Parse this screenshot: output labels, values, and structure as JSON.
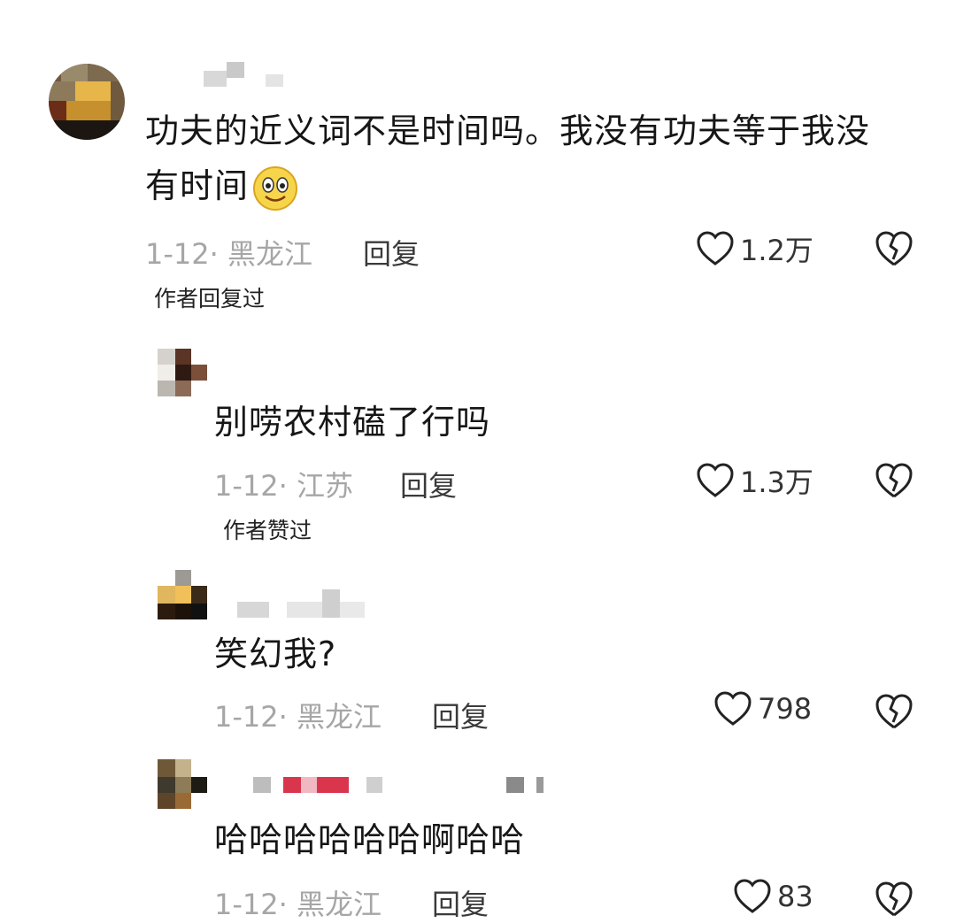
{
  "comments": [
    {
      "text_line1": "功夫的近义词不是时间吗。我没有功夫等于我没",
      "text_line2": "有时间",
      "emoji": "smiling-face-icon",
      "date": "1-12",
      "location": "黑龙江",
      "reply_label": "回复",
      "likes": "1.2万",
      "author_tag": "作者回复过"
    },
    {
      "text": "别唠农村磕了行吗",
      "date": "1-12",
      "location": "江苏",
      "reply_label": "回复",
      "likes": "1.3万",
      "author_tag": "作者赞过"
    },
    {
      "text": "笑幻我?",
      "date": "1-12",
      "location": "黑龙江",
      "reply_label": "回复",
      "likes": "798"
    },
    {
      "text": "哈哈哈哈哈哈啊哈哈",
      "date": "1-12",
      "location": "黑龙江",
      "reply_label": "回复",
      "likes": "83"
    }
  ],
  "separator": "·",
  "colors": {
    "text": "#161616",
    "meta": "#a6a6a6",
    "accent_blur": "#d9364e"
  }
}
